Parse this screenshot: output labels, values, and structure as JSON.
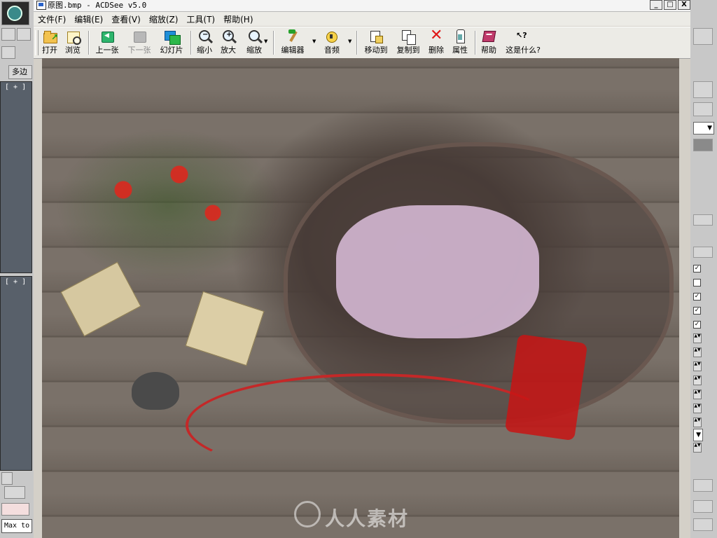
{
  "background_app": {
    "left_tab_label": "多边",
    "viewport_label_top": "[ + ]",
    "viewport_label_bottom": "[ + ]",
    "script_text": "Max to"
  },
  "window": {
    "title": "原图.bmp - ACDSee v5.0",
    "controls": {
      "minimize": "_",
      "maximize": "□",
      "close": "X"
    }
  },
  "menu": [
    {
      "label": "文件(F)"
    },
    {
      "label": "编辑(E)"
    },
    {
      "label": "查看(V)"
    },
    {
      "label": "缩放(Z)"
    },
    {
      "label": "工具(T)"
    },
    {
      "label": "帮助(H)"
    }
  ],
  "toolbar": {
    "open": "打开",
    "browse": "浏览",
    "prev": "上一张",
    "next": "下一张",
    "slideshow": "幻灯片",
    "zoom_out": "缩小",
    "zoom_in": "放大",
    "zoom": "缩放",
    "editor": "编辑器",
    "audio": "音频",
    "move_to": "移动到",
    "copy_to": "复制到",
    "delete": "删除",
    "properties": "属性",
    "help": "帮助",
    "whats_this": "这是什么?"
  },
  "image_view": {
    "watermark": "人人素材"
  },
  "colors": {
    "window_face": "#d4d0c8",
    "delete_red": "#e01818",
    "photo_wood": "#6d655e"
  }
}
